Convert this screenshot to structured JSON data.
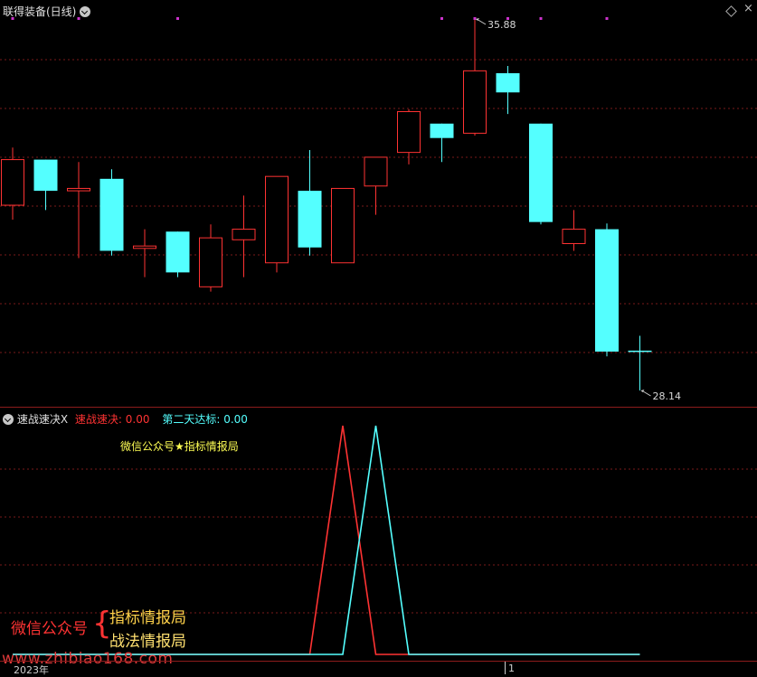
{
  "main_panel": {
    "title": "联得装备(日线)",
    "high_label": "35.88",
    "low_label": "28.14"
  },
  "indicator_panel": {
    "name": "速战速决X",
    "line1_label": "速战速决:",
    "line1_value": "0.00",
    "line2_label": "第二天达标:",
    "line2_value": "0.00",
    "watermark_top": "微信公众号★指标情报局"
  },
  "footer": {
    "left_text": "微信公众号",
    "brace": "{",
    "right_line1": "指标情报局",
    "right_line2": "战法情报局",
    "url": "www.zhibiao168.com",
    "year_label": "2023年",
    "tick_label": "1"
  },
  "colors": {
    "up": "#ff3333",
    "down": "#54ffff",
    "grid": "#7a1a1a",
    "signal_marker": "#cc33cc",
    "title_red": "#ff3333",
    "title_cyan": "#54ffff",
    "yellow": "#ffff54"
  },
  "chart_data": {
    "type": "candlestick",
    "price_max": 35.88,
    "price_min": 28.14,
    "candles": [
      {
        "o": 32.0,
        "h": 33.2,
        "l": 31.7,
        "c": 32.95,
        "dir": "up"
      },
      {
        "o": 32.95,
        "h": 32.95,
        "l": 31.9,
        "c": 32.3,
        "dir": "down"
      },
      {
        "o": 32.3,
        "h": 32.9,
        "l": 30.9,
        "c": 32.35,
        "dir": "up"
      },
      {
        "o": 32.55,
        "h": 32.75,
        "l": 30.95,
        "c": 31.05,
        "dir": "down"
      },
      {
        "o": 31.1,
        "h": 31.5,
        "l": 30.5,
        "c": 31.15,
        "dir": "up"
      },
      {
        "o": 31.45,
        "h": 31.45,
        "l": 30.5,
        "c": 30.6,
        "dir": "down"
      },
      {
        "o": 30.3,
        "h": 31.6,
        "l": 30.2,
        "c": 31.32,
        "dir": "up"
      },
      {
        "o": 31.28,
        "h": 32.2,
        "l": 30.5,
        "c": 31.5,
        "dir": "up"
      },
      {
        "o": 30.8,
        "h": 32.6,
        "l": 30.6,
        "c": 32.6,
        "dir": "up"
      },
      {
        "o": 32.3,
        "h": 33.15,
        "l": 30.95,
        "c": 31.12,
        "dir": "down"
      },
      {
        "o": 30.8,
        "h": 32.35,
        "l": 30.8,
        "c": 32.35,
        "dir": "up"
      },
      {
        "o": 32.4,
        "h": 33.0,
        "l": 31.8,
        "c": 33.0,
        "dir": "up"
      },
      {
        "o": 33.1,
        "h": 34.0,
        "l": 32.85,
        "c": 33.95,
        "dir": "up"
      },
      {
        "o": 33.7,
        "h": 33.7,
        "l": 32.9,
        "c": 33.4,
        "dir": "down"
      },
      {
        "o": 33.5,
        "h": 35.88,
        "l": 33.45,
        "c": 34.8,
        "dir": "up"
      },
      {
        "o": 34.75,
        "h": 34.9,
        "l": 33.9,
        "c": 34.35,
        "dir": "down"
      },
      {
        "o": 33.7,
        "h": 33.7,
        "l": 31.6,
        "c": 31.65,
        "dir": "down"
      },
      {
        "o": 31.5,
        "h": 31.9,
        "l": 31.05,
        "c": 31.2,
        "dir": "up"
      },
      {
        "o": 31.5,
        "h": 31.62,
        "l": 28.85,
        "c": 28.95,
        "dir": "down"
      },
      {
        "o": 28.97,
        "h": 29.28,
        "l": 28.14,
        "c": 28.97,
        "dir": "down"
      }
    ],
    "signal_marker_candles": [
      0,
      2,
      5,
      13,
      14,
      15,
      16,
      18
    ],
    "indicator": {
      "series": [
        {
          "key": "速战速决",
          "color": "#ff3333",
          "values": [
            0,
            0,
            0,
            0,
            0,
            0,
            0,
            0,
            0,
            0,
            1,
            0,
            0,
            0,
            0,
            0,
            0,
            0,
            0,
            0
          ]
        },
        {
          "key": "第二天达标",
          "color": "#54ffff",
          "values": [
            0,
            0,
            0,
            0,
            0,
            0,
            0,
            0,
            0,
            0,
            0,
            1,
            0,
            0,
            0,
            0,
            0,
            0,
            0,
            0
          ]
        }
      ]
    }
  }
}
